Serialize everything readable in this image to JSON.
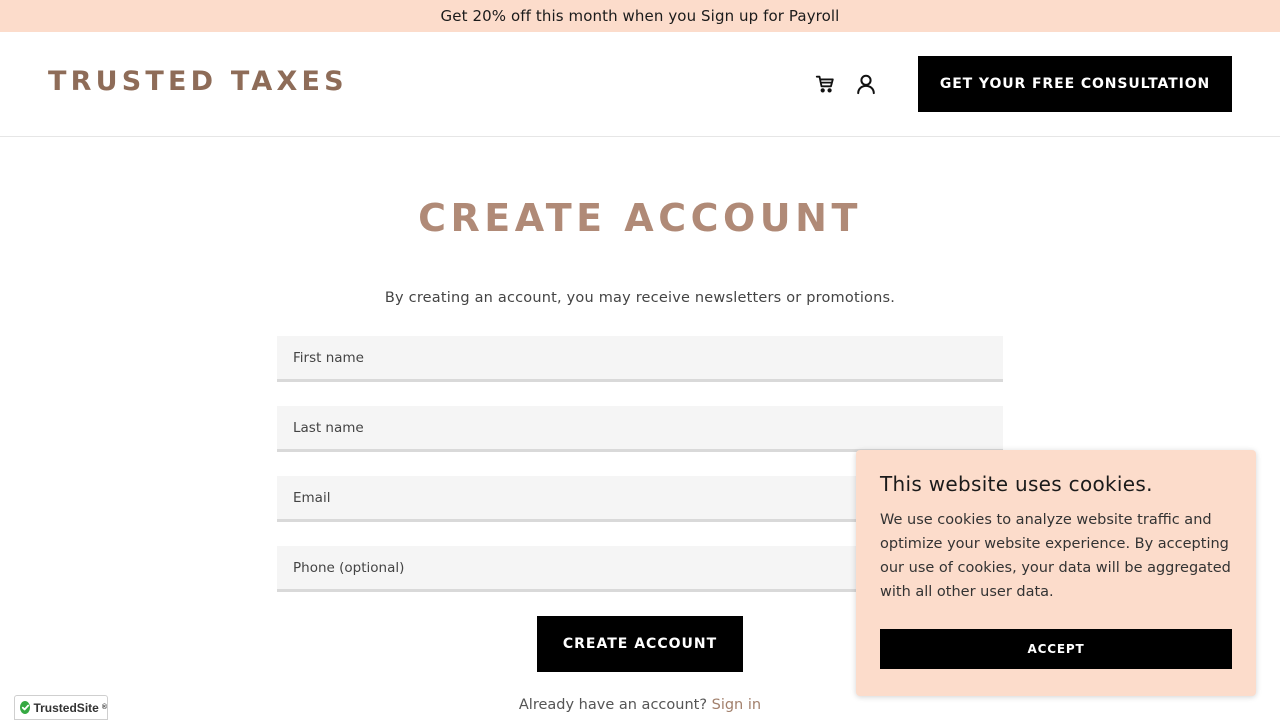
{
  "promo": {
    "text": "Get 20% off this month when you Sign up for Payroll"
  },
  "header": {
    "logo": "TRUSTED TAXES",
    "consult_label": "GET YOUR FREE CONSULTATION",
    "icons": {
      "cart": "cart-icon",
      "account": "user-icon"
    }
  },
  "main": {
    "title": "CREATE ACCOUNT",
    "subtitle": "By creating an account, you may receive newsletters or promotions.",
    "fields": [
      {
        "placeholder": "First name",
        "value": ""
      },
      {
        "placeholder": "Last name",
        "value": ""
      },
      {
        "placeholder": "Email",
        "value": ""
      },
      {
        "placeholder": "Phone (optional)",
        "value": ""
      }
    ],
    "submit_label": "CREATE ACCOUNT",
    "signin_prompt": "Already have an account?",
    "signin_link": "Sign in"
  },
  "cookie": {
    "title": "This website uses cookies.",
    "body": "We use cookies to analyze website traffic and optimize your website experience. By accepting our use of cookies, your data will be aggregated with all other user data.",
    "accept_label": "ACCEPT"
  },
  "badge": {
    "label": "TrustedSite",
    "mark": "®"
  },
  "colors": {
    "promo_bg": "#fcdccb",
    "logo": "#8e6c58",
    "title": "#b08a77",
    "link": "#a2806c",
    "button": "#000000",
    "badge_check": "#35a942"
  }
}
